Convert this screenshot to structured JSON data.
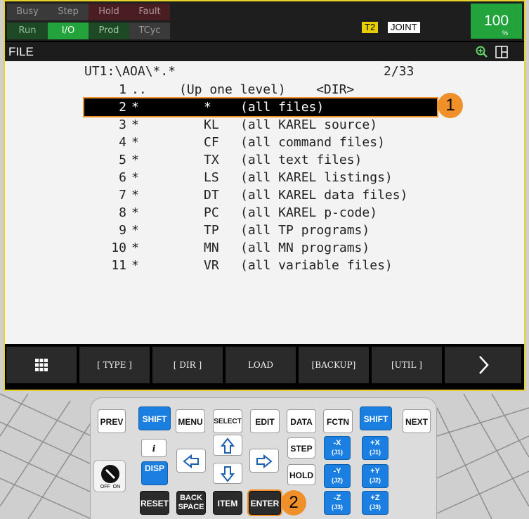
{
  "status": {
    "busy": "Busy",
    "step": "Step",
    "hold": "Hold",
    "fault": "Fault",
    "run": "Run",
    "io": "I/O",
    "prod": "Prod",
    "tcyc": "TCyc",
    "mode": "T2",
    "coord": "JOINT",
    "override_value": "100",
    "override_unit": "%"
  },
  "screen": {
    "title": "FILE",
    "icons": [
      "zoom-in-icon",
      "split-screen-icon"
    ]
  },
  "file_list": {
    "path": "UT1:\\AOA\\*.*",
    "count": "2/33",
    "rows": [
      {
        "num": "1",
        "star": "..",
        "ext": "",
        "desc": "(Up one level)    <DIR>"
      },
      {
        "num": "2",
        "star": "*",
        "ext": "*",
        "desc": "(all files)"
      },
      {
        "num": "3",
        "star": "*",
        "ext": "KL",
        "desc": "(all KAREL source)"
      },
      {
        "num": "4",
        "star": "*",
        "ext": "CF",
        "desc": "(all command files)"
      },
      {
        "num": "5",
        "star": "*",
        "ext": "TX",
        "desc": "(all text files)"
      },
      {
        "num": "6",
        "star": "*",
        "ext": "LS",
        "desc": "(all KAREL listings)"
      },
      {
        "num": "7",
        "star": "*",
        "ext": "DT",
        "desc": "(all KAREL data files)"
      },
      {
        "num": "8",
        "star": "*",
        "ext": "PC",
        "desc": "(all KAREL p-code)"
      },
      {
        "num": "9",
        "star": "*",
        "ext": "TP",
        "desc": "(all TP programs)"
      },
      {
        "num": "10",
        "star": "*",
        "ext": "MN",
        "desc": "(all MN programs)"
      },
      {
        "num": "11",
        "star": "*",
        "ext": "VR",
        "desc": "(all variable files)"
      }
    ],
    "selected_index": 1
  },
  "function_keys": [
    "[ TYPE ]",
    "[ DIR ]",
    "LOAD",
    "[BACKUP]",
    "[UTIL ]"
  ],
  "keypad": {
    "prev": "PREV",
    "shift": "SHIFT",
    "menu": "MENU",
    "select": "SELECT",
    "edit": "EDIT",
    "data": "DATA",
    "fctn": "FCTN",
    "next": "NEXT",
    "info": "i",
    "disp": "DISP",
    "step": "STEP",
    "hold": "HOLD",
    "reset": "RESET",
    "back_space_1": "BACK",
    "back_space_2": "SPACE",
    "item": "ITEM",
    "enter": "ENTER",
    "minus_x": "-X",
    "plus_x": "+X",
    "j1": "(J1)",
    "minus_y": "-Y",
    "plus_y": "+Y",
    "j2": "(J2)",
    "minus_z": "-Z",
    "plus_z": "+Z",
    "j3": "(J3)",
    "off_on": "OFF  ON"
  },
  "callouts": {
    "one": "1",
    "two": "2"
  },
  "colors": {
    "accent": "#f0902a",
    "status_green": "#22a33c",
    "shift_blue": "#1a7fe0",
    "frame_yellow": "#e6d42a"
  }
}
